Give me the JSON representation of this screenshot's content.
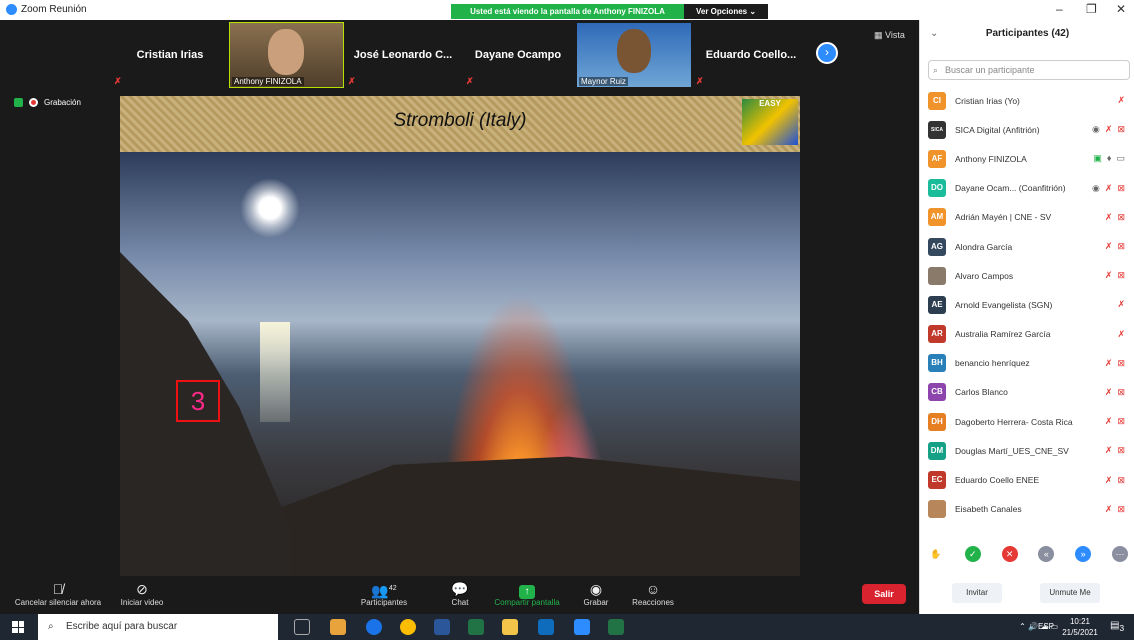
{
  "window": {
    "title": "Zoom Reunión",
    "minimize": "–",
    "maximize": "❐",
    "close": "✕"
  },
  "share_banner": {
    "text": "Usted está viendo la pantalla de Anthony FINIZOLA",
    "view_options": "Ver Opciones ⌄"
  },
  "strip": {
    "tiles": [
      {
        "name": "Cristian Irias"
      },
      {
        "name": "José Leonardo C..."
      },
      {
        "name": "Dayane Ocampo"
      },
      {
        "name": "Eduardo Coello..."
      }
    ],
    "video_tiles": [
      {
        "label": "Anthony FINIZOLA"
      },
      {
        "label": "Maynor Ruiz"
      }
    ],
    "vista": "Vista"
  },
  "recording": {
    "label": "Grabación"
  },
  "slide": {
    "title": "Stromboli (Italy)",
    "logo_text": "EASY",
    "number_box": "3"
  },
  "toolbar": {
    "mute": "Cancelar silenciar ahora",
    "video": "Iniciar video",
    "participants": "Participantes",
    "participants_count": "42",
    "chat": "Chat",
    "share": "Compartir pantalla",
    "record": "Grabar",
    "reactions": "Reacciones",
    "leave": "Salir"
  },
  "panel": {
    "title": "Participantes (42)",
    "search_placeholder": "Buscar un participante",
    "participants": [
      {
        "initials": "CI",
        "name": "Cristian Irias (Yo)",
        "color": "#f0932b"
      },
      {
        "initials": "SICA",
        "name": "SICA Digital (Anfitrión)",
        "color": "#333333"
      },
      {
        "initials": "AF",
        "name": "Anthony FINIZOLA",
        "color": "#f0932b"
      },
      {
        "initials": "DO",
        "name": "Dayane Ocam...  (Coanfitrión)",
        "color": "#1abc9c"
      },
      {
        "initials": "AM",
        "name": "Adrián Mayén | CNE - SV",
        "color": "#f0932b"
      },
      {
        "initials": "AG",
        "name": "Alondra García",
        "color": "#34495e"
      },
      {
        "initials": "",
        "name": "Alvaro Campos",
        "color": "#8a7a6a"
      },
      {
        "initials": "AE",
        "name": "Arnold Evangelista (SGN)",
        "color": "#2c3e50"
      },
      {
        "initials": "AR",
        "name": "Australia Ramírez García",
        "color": "#c0392b"
      },
      {
        "initials": "BH",
        "name": "benancio henríquez",
        "color": "#2980b9"
      },
      {
        "initials": "CB",
        "name": "Carlos Blanco",
        "color": "#8e44ad"
      },
      {
        "initials": "DH",
        "name": "Dagoberto Herrera- Costa Rica",
        "color": "#e67e22"
      },
      {
        "initials": "DM",
        "name": "Douglas Martí_UES_CNE_SV",
        "color": "#16a085"
      },
      {
        "initials": "EC",
        "name": "Eduardo Coello ENEE",
        "color": "#c0392b"
      },
      {
        "initials": "",
        "name": "Eisabeth Canales",
        "color": "#b7865a"
      }
    ],
    "invite": "Invitar",
    "unmute": "Unmute Me"
  },
  "taskbar": {
    "search_placeholder": "Escribe aquí para buscar",
    "lang": "ESP",
    "time": "10:21",
    "date": "21/5/2021",
    "notif": "3"
  }
}
